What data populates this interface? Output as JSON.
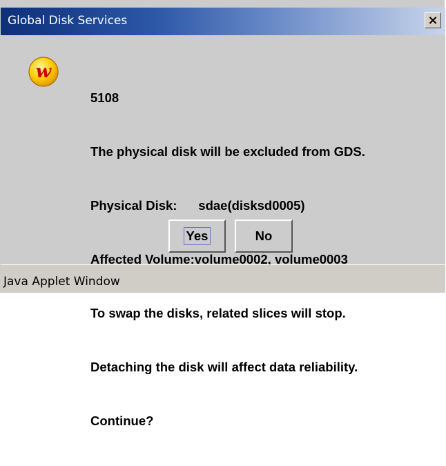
{
  "window": {
    "title": "Global Disk Services",
    "close_label": "×"
  },
  "icon": {
    "name": "warning-w-icon",
    "glyph": "w",
    "fill_color": "#ffcc00",
    "glyph_color": "#cc0000"
  },
  "message": {
    "lines": [
      "5108",
      "The physical disk will be excluded from GDS.",
      "Physical Disk:      sdae(disksd0005)",
      "Affected Volume:volume0002, volume0003",
      "To swap the disks, related slices will stop.",
      "Detaching the disk will affect data reliability.",
      "Continue?"
    ]
  },
  "buttons": {
    "yes_label": "Yes",
    "no_label": "No"
  },
  "status_bar": {
    "text": "Java Applet Window"
  }
}
